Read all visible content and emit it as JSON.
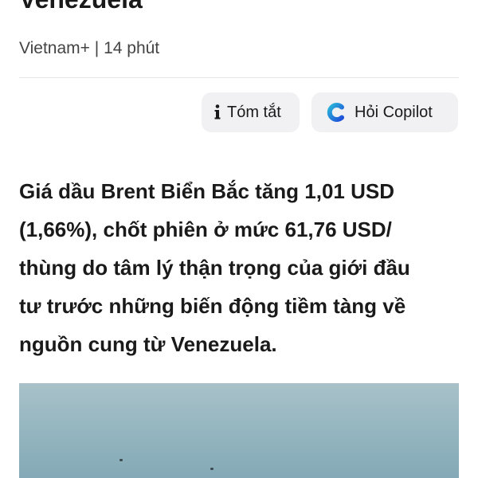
{
  "article": {
    "title": "Venezuela",
    "source": "Vietnam+",
    "separator": "|",
    "time": "14 phút",
    "summary_lines": [
      "Giá dầu Brent Biển Bắc tăng 1,01 USD",
      "(1,66%), chốt phiên ở mức 61,76 USD/",
      "thùng do tâm lý thận trọng của giới đầu",
      "tư trước những biến động tiềm tàng về",
      "nguồn cung từ Venezuela."
    ]
  },
  "actions": {
    "summary_label": "Tóm tắt",
    "copilot_label": "Hỏi Copilot"
  },
  "icons": {
    "summary_icon": "info-icon",
    "copilot_icon": "copilot-icon"
  },
  "colors": {
    "button_bg": "#f1f1f3",
    "text": "#1a1a1a",
    "copilot_blue": "#1e6fd9",
    "copilot_teal": "#2bb5d8"
  }
}
